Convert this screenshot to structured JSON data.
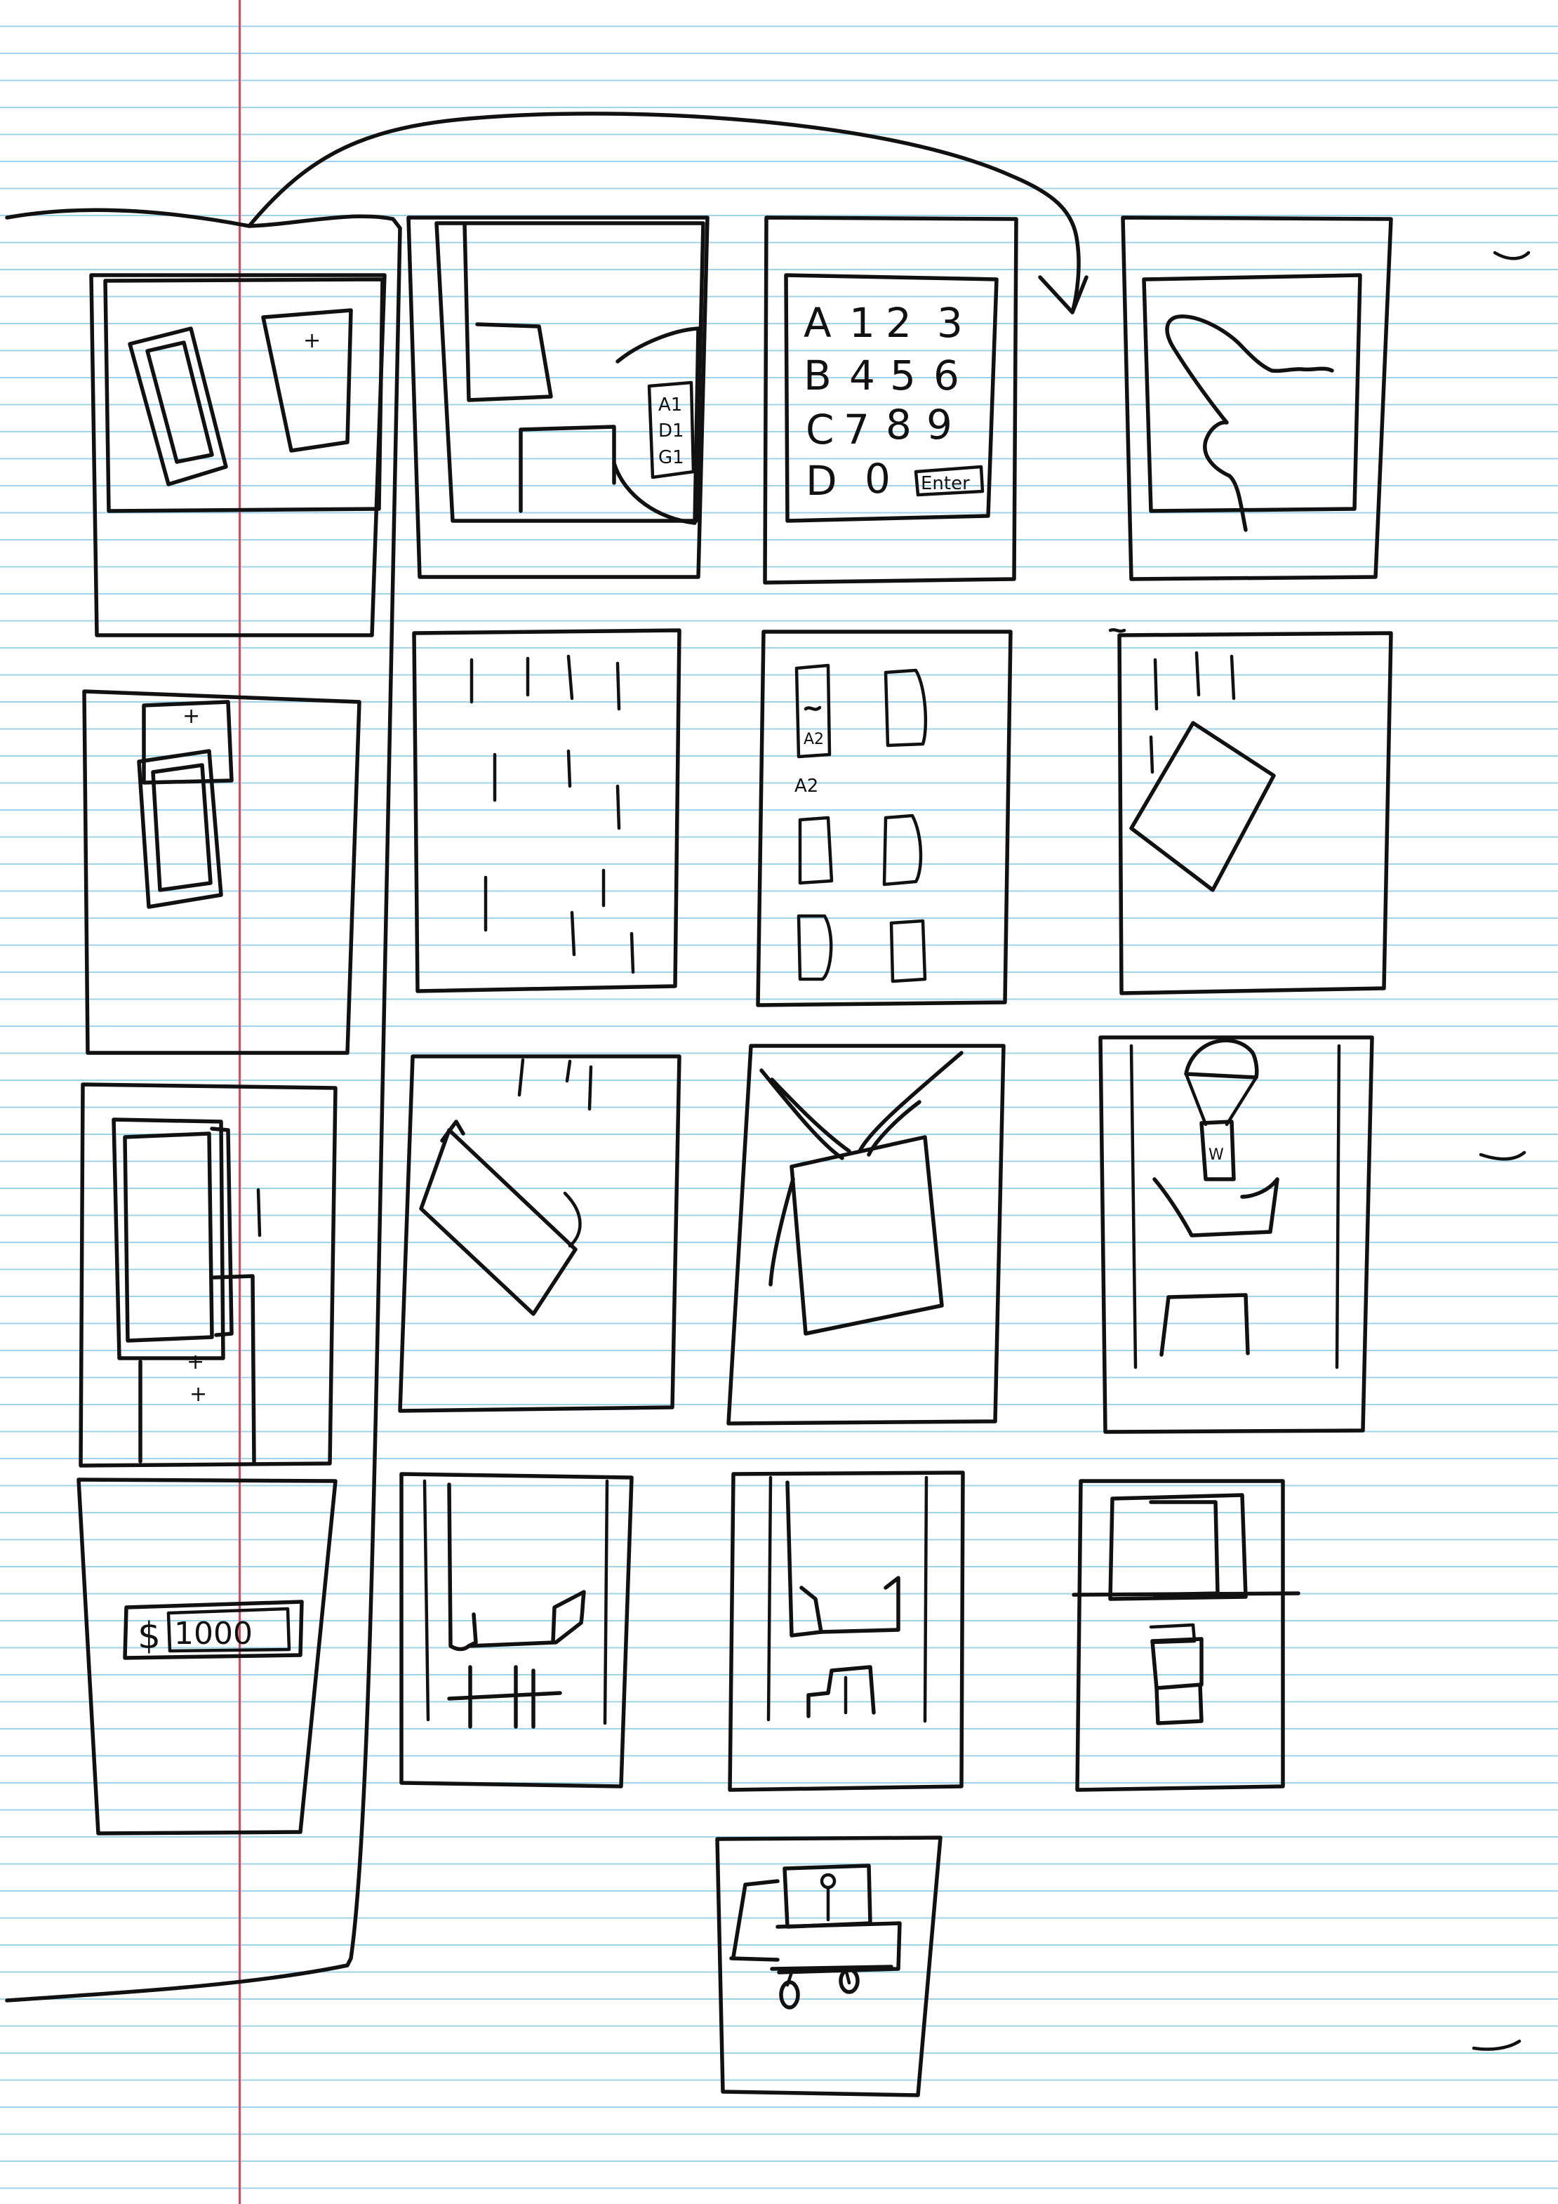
{
  "sketch": {
    "keypad": {
      "rows": [
        [
          "A",
          "1",
          "2",
          "3"
        ],
        [
          "B",
          "4",
          "5",
          "6"
        ],
        [
          "C",
          "7",
          "8",
          "9"
        ],
        [
          "D",
          "0"
        ]
      ],
      "enter_label": "Enter"
    },
    "side_list": [
      "A1",
      "D1",
      "G1"
    ],
    "item_labels": [
      "A2",
      "A2"
    ],
    "money": {
      "symbol": "$",
      "amount": "1000"
    },
    "mark_glyph": "W",
    "marks": [
      "+",
      "+",
      "+",
      "+"
    ]
  }
}
